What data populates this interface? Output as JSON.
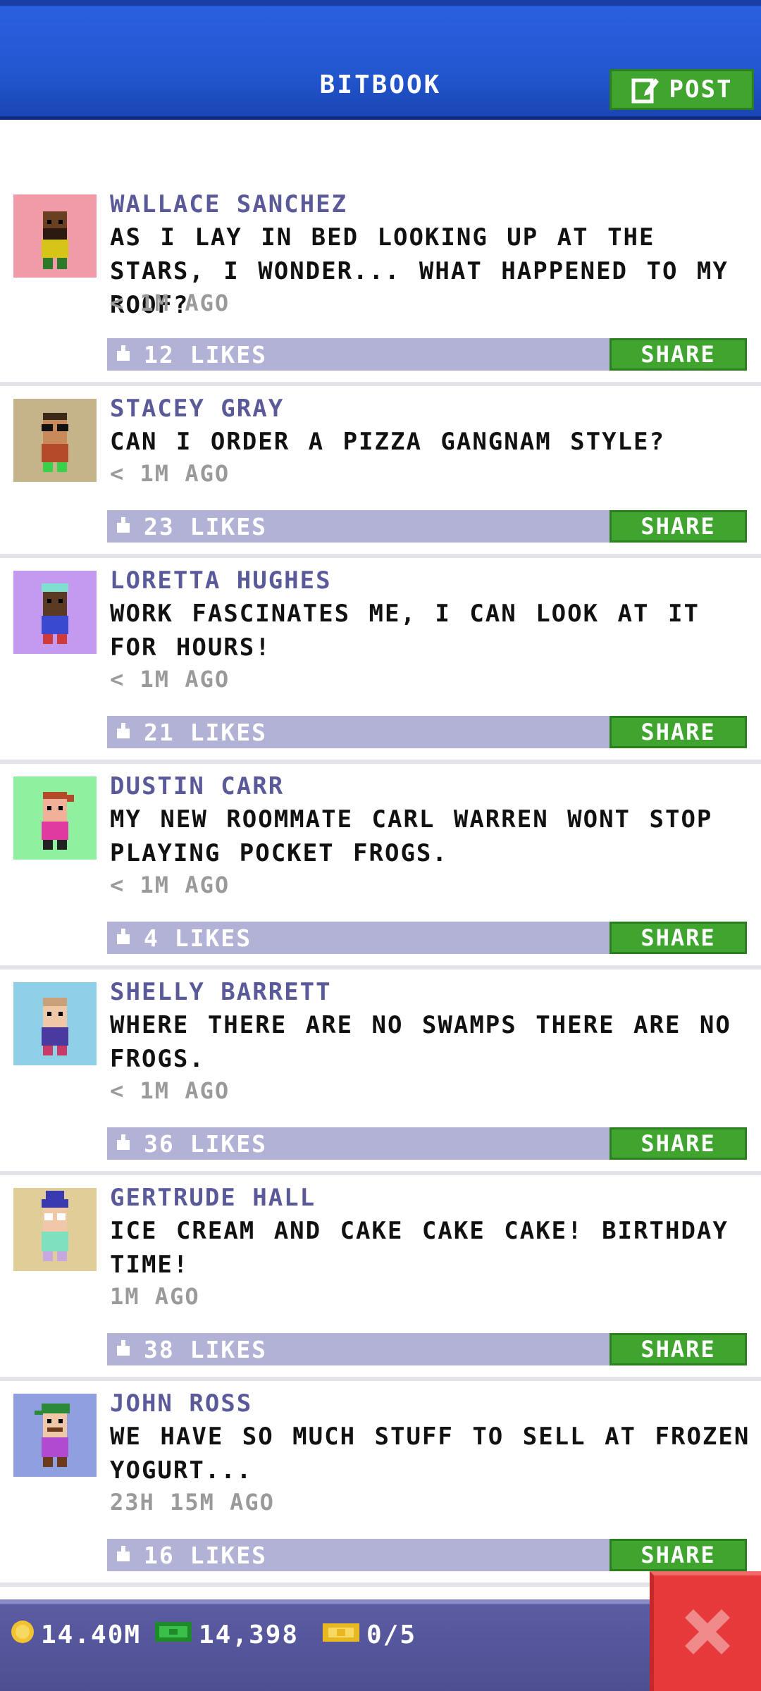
{
  "header": {
    "title": "BITBOOK",
    "post_label": "POST"
  },
  "share_label": "SHARE",
  "posts": [
    {
      "name": "WALLACE SANCHEZ",
      "text": "AS I LAY IN BED LOOKING UP AT THE STARS, I WONDER... WHAT HAPPENED TO MY ROOF?",
      "time": "< 1M AGO",
      "likes": "12 LIKES",
      "avatar_bg": "#f19aa8"
    },
    {
      "name": "STACEY GRAY",
      "text": "CAN I ORDER A PIZZA GANGNAM STYLE?",
      "time": "< 1M AGO",
      "likes": "23 LIKES",
      "avatar_bg": "#c5b38a"
    },
    {
      "name": "LORETTA HUGHES",
      "text": "WORK FASCINATES ME, I CAN LOOK AT IT FOR HOURS!",
      "time": "< 1M AGO",
      "likes": "21 LIKES",
      "avatar_bg": "#c39af0"
    },
    {
      "name": "DUSTIN CARR",
      "text": "MY NEW ROOMMATE CARL WARREN WONT STOP PLAYING POCKET FROGS.",
      "time": "< 1M AGO",
      "likes": "4 LIKES",
      "avatar_bg": "#8ff0a0"
    },
    {
      "name": "SHELLY BARRETT",
      "text": "WHERE THERE ARE NO SWAMPS THERE ARE NO FROGS.",
      "time": "< 1M AGO",
      "likes": "36 LIKES",
      "avatar_bg": "#8fd0e6"
    },
    {
      "name": "GERTRUDE HALL",
      "text": "ICE CREAM AND CAKE CAKE CAKE! BIRTHDAY TIME!",
      "time": "1M AGO",
      "likes": "38 LIKES",
      "avatar_bg": "#e0cd98"
    },
    {
      "name": "JOHN ROSS",
      "text": "WE HAVE SO MUCH STUFF TO SELL AT FROZEN YOGURT...",
      "time": "23H 15M AGO",
      "likes": "16 LIKES",
      "avatar_bg": "#8f9fe0"
    }
  ],
  "bottom": {
    "coins": "14.40M",
    "bux": "14,398",
    "tickets": "0/5"
  },
  "colors": {
    "header_blue": "#2357d0",
    "share_green": "#3fa52f",
    "like_bar": "#b2b2d6",
    "close_red": "#e8393a"
  }
}
